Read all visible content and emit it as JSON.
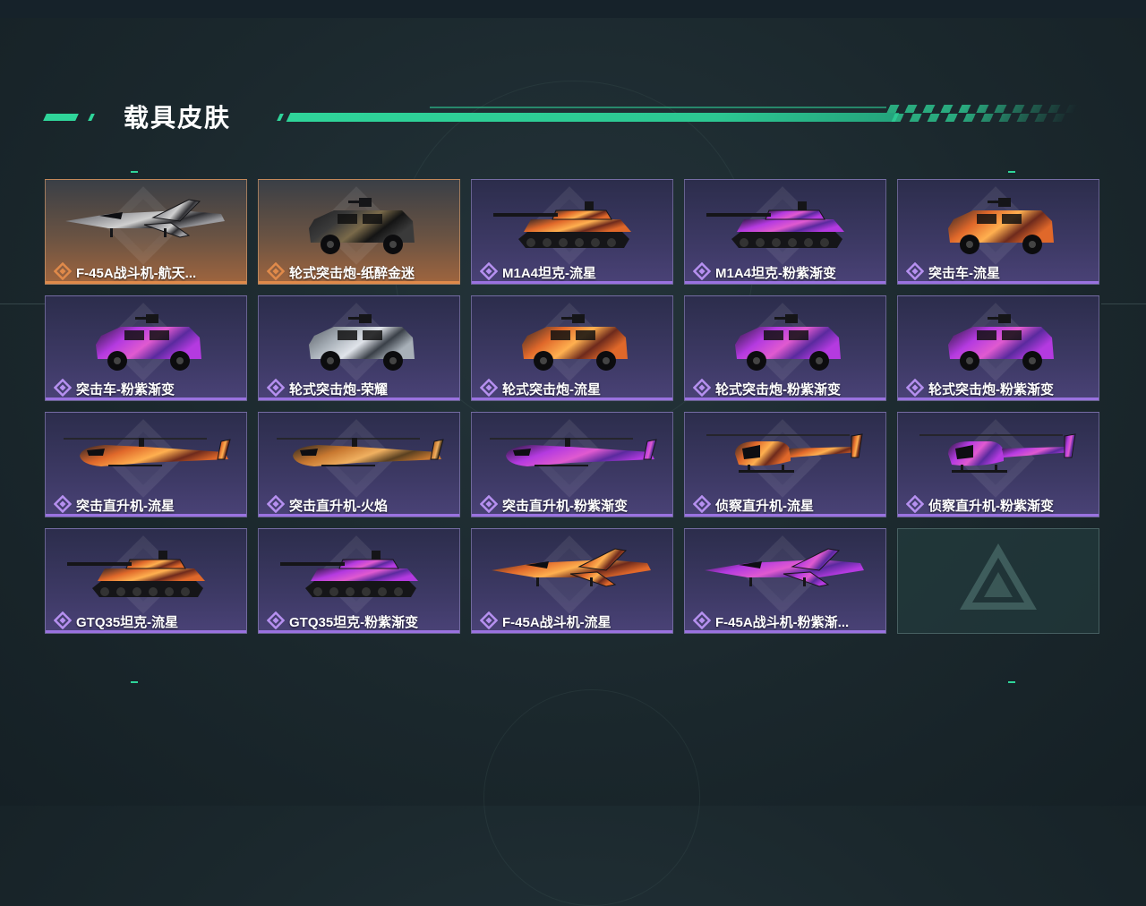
{
  "page": {
    "title": "载具皮肤"
  },
  "colors": {
    "accent": "#2fd59a",
    "epic": "#9a72e0",
    "legendary": "#e08a4a"
  },
  "skins": [
    {
      "name": "F-45A战斗机-航天...",
      "rarity": "legendary",
      "vehicle": "jet",
      "scheme": "gray"
    },
    {
      "name": "轮式突击炮-纸醉金迷",
      "rarity": "legendary",
      "vehicle": "armored-car",
      "scheme": "black"
    },
    {
      "name": "M1A4坦克-流星",
      "rarity": "epic",
      "vehicle": "tank",
      "scheme": "meteor"
    },
    {
      "name": "M1A4坦克-粉紫渐变",
      "rarity": "epic",
      "vehicle": "tank",
      "scheme": "pink"
    },
    {
      "name": "突击车-流星",
      "rarity": "epic",
      "vehicle": "assault-truck",
      "scheme": "meteor"
    },
    {
      "name": "突击车-粉紫渐变",
      "rarity": "epic",
      "vehicle": "assault-truck",
      "scheme": "pink"
    },
    {
      "name": "轮式突击炮-荣耀",
      "rarity": "epic",
      "vehicle": "armored-car",
      "scheme": "silver"
    },
    {
      "name": "轮式突击炮-流星",
      "rarity": "epic",
      "vehicle": "armored-car",
      "scheme": "meteor"
    },
    {
      "name": "轮式突击炮-粉紫渐变",
      "rarity": "epic",
      "vehicle": "armored-car",
      "scheme": "pink"
    },
    {
      "name": "轮式突击炮-粉紫渐变",
      "rarity": "epic",
      "vehicle": "armored-car",
      "scheme": "pink"
    },
    {
      "name": "突击直升机-流星",
      "rarity": "epic",
      "vehicle": "attack-helicopter",
      "scheme": "meteor"
    },
    {
      "name": "突击直升机-火焰",
      "rarity": "epic",
      "vehicle": "attack-helicopter",
      "scheme": "flame"
    },
    {
      "name": "突击直升机-粉紫渐变",
      "rarity": "epic",
      "vehicle": "attack-helicopter",
      "scheme": "pink"
    },
    {
      "name": "侦察直升机-流星",
      "rarity": "epic",
      "vehicle": "scout-helicopter",
      "scheme": "meteor"
    },
    {
      "name": "侦察直升机-粉紫渐变",
      "rarity": "epic",
      "vehicle": "scout-helicopter",
      "scheme": "pink"
    },
    {
      "name": "GTQ35坦克-流星",
      "rarity": "epic",
      "vehicle": "tank",
      "scheme": "meteor"
    },
    {
      "name": "GTQ35坦克-粉紫渐变",
      "rarity": "epic",
      "vehicle": "tank",
      "scheme": "pink"
    },
    {
      "name": "F-45A战斗机-流星",
      "rarity": "epic",
      "vehicle": "jet",
      "scheme": "meteor"
    },
    {
      "name": "F-45A战斗机-粉紫渐...",
      "rarity": "epic",
      "vehicle": "jet",
      "scheme": "pink"
    },
    {
      "name": "",
      "rarity": "empty",
      "vehicle": "logo-placeholder",
      "scheme": ""
    }
  ]
}
